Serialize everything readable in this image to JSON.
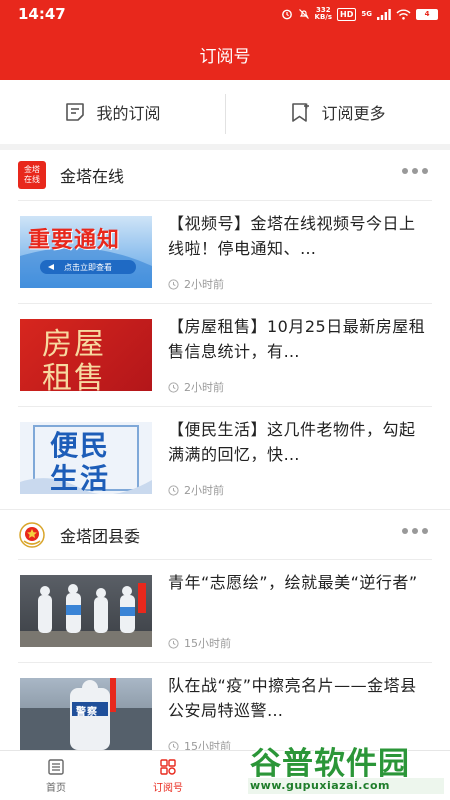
{
  "status_bar": {
    "time": "14:47",
    "net_speed_value": "332",
    "net_speed_unit": "KB/s",
    "hd_label": "HD",
    "signal_label": "5G",
    "battery": "4"
  },
  "header": {
    "title": "订阅号"
  },
  "subscription_bar": {
    "my_subscriptions": "我的订阅",
    "subscribe_more": "订阅更多"
  },
  "channels": [
    {
      "name": "金塔在线",
      "logo_text_top": "金塔",
      "logo_text_bottom": "在线",
      "articles": [
        {
          "title": "【视频号】金塔在线视频号今日上线啦！停电通知、…",
          "time": "2小时前",
          "thumb_main": "重要通知",
          "thumb_sub": "点击立即查看"
        },
        {
          "title": "【房屋租售】10月25日最新房屋租售信息统计，有…",
          "time": "2小时前",
          "thumb_line1": "房屋",
          "thumb_line2": "租售"
        },
        {
          "title": "【便民生活】这几件老物件，勾起满满的回忆，快…",
          "time": "2小时前",
          "thumb_line1": "便民",
          "thumb_line2": "生活"
        }
      ]
    },
    {
      "name": "金塔团县委",
      "articles": [
        {
          "title": "青年“志愿绘”，绘就最美“逆行者”",
          "time": "15小时前"
        },
        {
          "title": "队在战“疫”中擦亮名片——金塔县公安局特巡警…",
          "time": "15小时前",
          "thumb_label": "警察"
        }
      ]
    }
  ],
  "tabbar": {
    "home": "首页",
    "subscriptions": "订阅号"
  },
  "watermark": {
    "brand": "谷普软件园",
    "url": "www.gupuxiazai.com"
  },
  "colors": {
    "brand_red": "#e8281c",
    "text_dark": "#222222",
    "text_muted": "#9a9a9a"
  }
}
